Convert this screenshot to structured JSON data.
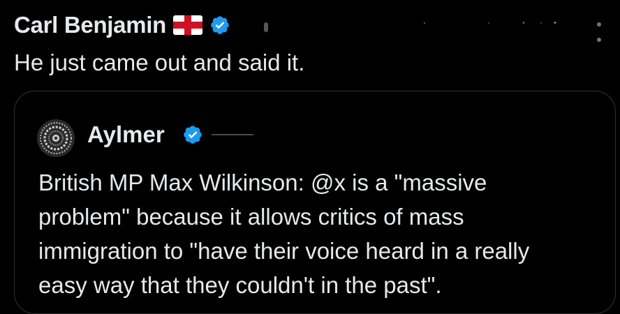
{
  "tweet": {
    "author_name": "Carl Benjamin",
    "author_flag_icon": "england-flag-icon",
    "author_verified_icon": "verified-badge-icon",
    "text": "He just came out and said it."
  },
  "quoted_tweet": {
    "author_name": "Aylmer",
    "author_verified_icon": "verified-badge-icon",
    "text_lines": [
      "British MP Max Wilkinson: @x is a \"massive",
      "problem\" because it allows critics of mass",
      "immigration to \"have their voice heard in a really",
      "easy way that they couldn't in the past\"."
    ]
  },
  "colors": {
    "background": "#000000",
    "text": "#e7e9ea",
    "secondary": "#71767b",
    "verified_blue": "#1d9bf0",
    "border": "#2f3336",
    "flag_red": "#ce1124"
  }
}
